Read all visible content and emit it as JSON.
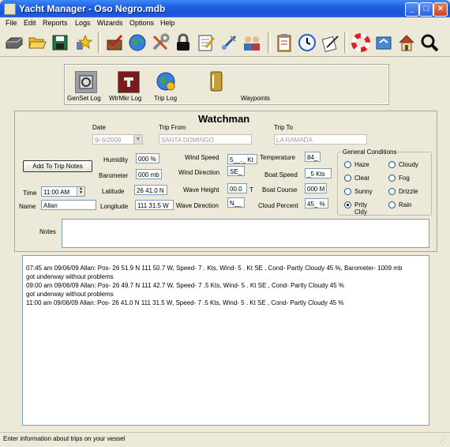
{
  "window": {
    "title": "Yacht Manager - Oso Negro.mdb"
  },
  "menu": [
    "File",
    "Edit",
    "Reports",
    "Logs",
    "Wizards",
    "Options",
    "Help"
  ],
  "toolbar": [
    "hard-drive-icon",
    "folder-open-icon",
    "save-icon",
    "star-icon",
    "checkmark-crate-icon",
    "globe-icon",
    "tools-icon",
    "lock-icon",
    "notepad-icon",
    "pump-icon",
    "people-icon",
    "clipboard-icon",
    "clock-icon",
    "sign-document-icon",
    "life-ring-icon",
    "recycle-icon",
    "house-icon",
    "magnifier-icon"
  ],
  "logs": {
    "genset": "GenSet Log",
    "wtrmkr": "WtrMkr Log",
    "trip": "Trip Log",
    "waypoints": "Waypoints"
  },
  "form": {
    "heading": "Watchman",
    "date_label": "Date",
    "date_value": "9/  6/2009",
    "trip_from_label": "Trip From",
    "trip_from_value": "SANTA DOMINGO",
    "trip_to_label": "Trip To",
    "trip_to_value": "LA RAMADA",
    "add_button": "Add To Trip Notes",
    "time_label": "Time",
    "time_value": "11:00 AM",
    "name_label": "Name",
    "name_value": "Allan",
    "humidity_label": "Humidity",
    "humidity_value": "000 %",
    "barometer_label": "Barometer",
    "barometer_value": "000 mb",
    "latitude_label": "Latitude",
    "latitude_value": "26 41.0 N",
    "longitude_label": "Longitude",
    "longitude_value": "111 31.5 W",
    "wind_speed_label": "Wind Speed",
    "wind_speed_value": "5__._ Kt",
    "wind_direction_label": "Wind Direction",
    "wind_direction_value": "SE_",
    "wave_height_label": "Wave Height",
    "wave_height_value": "00.0",
    "wave_height_unit": "T",
    "wave_direction_label": "Wave Direction",
    "wave_direction_value": "N__",
    "temperature_label": "Temperature",
    "temperature_value": "84_",
    "boat_speed_label": "Boat Speed",
    "boat_speed_value": "_5 Kts",
    "boat_course_label": "Boat Course",
    "boat_course_value": "000 M",
    "cloud_percent_label": "Cloud Percent",
    "cloud_percent_value": "45_ %",
    "conditions_label": "General Conditions",
    "conditions": [
      {
        "label": "Haze",
        "selected": false
      },
      {
        "label": "Cloudy",
        "selected": false
      },
      {
        "label": "Clear",
        "selected": false
      },
      {
        "label": "Fog",
        "selected": false
      },
      {
        "label": "Sunny",
        "selected": false
      },
      {
        "label": "Drizzle",
        "selected": false
      },
      {
        "label": "Prtly Cldy",
        "selected": true
      },
      {
        "label": "Rain",
        "selected": false
      }
    ],
    "notes_label": "Notes"
  },
  "log_lines": [
    "07:45 am  09/06/09  Allan: Pos- 26 51.9 N 111 50.7 W, Speed- 7 . Kts, Wind- 5  .  Kt SE , Cond- Partly Cloudy 45  %, Barometer- 1009 mb",
    "got underway without problems",
    "09:00 am  09/06/09  Allan: Pos- 26 49.7 N 111 42.7 W, Speed- 7 .5 Kts, Wind- 5  .  Kt SE , Cond- Partly Cloudy 45  %",
    "got underway without problems",
    "11:00 am  09/06/09  Allan: Pos- 26 41.0 N 111 31.5 W, Speed- 7 .5 Kts, Wind- 5  .  Kt SE , Cond- Partly Cloudy 45  %"
  ],
  "status": "Enter information about trips on your vessel"
}
